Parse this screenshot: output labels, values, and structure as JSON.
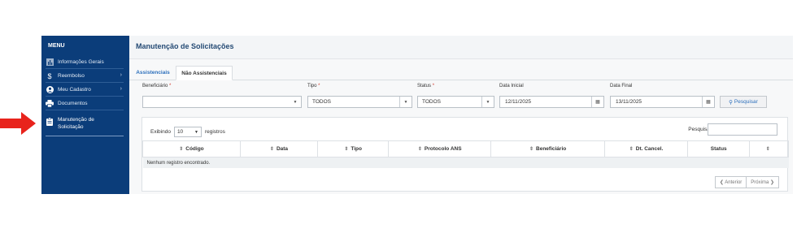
{
  "sidebar": {
    "menu_title": "MENU",
    "items": [
      {
        "label": "Informações Gerais",
        "icon": "chart-icon",
        "chevron": false
      },
      {
        "label": "Reembolso",
        "icon": "dollar-icon",
        "chevron": true
      },
      {
        "label": "Meu Cadastro",
        "icon": "user-icon",
        "chevron": true
      },
      {
        "label": "Documentos",
        "icon": "printer-icon",
        "chevron": false
      },
      {
        "label": "Manutenção de Solicitação",
        "icon": "clipboard-icon",
        "chevron": false,
        "active": true
      }
    ]
  },
  "header": {
    "title": "Manutenção de Solicitações"
  },
  "tabs": [
    "Assistenciais",
    "Não Assistenciais"
  ],
  "filters": {
    "beneficiario_label": "Beneficiário",
    "tipo_label": "Tipo",
    "tipo_value": "TODOS",
    "status_label": "Status",
    "status_value": "TODOS",
    "data_inicial_label": "Data Inicial",
    "data_inicial_value": "12/11/2025",
    "data_final_label": "Data Final",
    "data_final_value": "13/11/2025",
    "required_mark": "*",
    "search_button": "Pesquisar"
  },
  "table": {
    "show_prefix": "Exibindo",
    "page_size": "10",
    "show_suffix": "registros",
    "search_label": "Pesquisar:",
    "columns": [
      "Código",
      "Data",
      "Tipo",
      "Protocolo ANS",
      "Beneficiário",
      "Dt. Cancel.",
      "Status",
      ""
    ],
    "empty_message": "Nenhum registro encontrado.",
    "prev_label": "Anterior",
    "next_label": "Próxima"
  },
  "colors": {
    "sidebar": "#0b3d7a",
    "accent": "#2c6fbc",
    "arrow": "#e8231c"
  }
}
